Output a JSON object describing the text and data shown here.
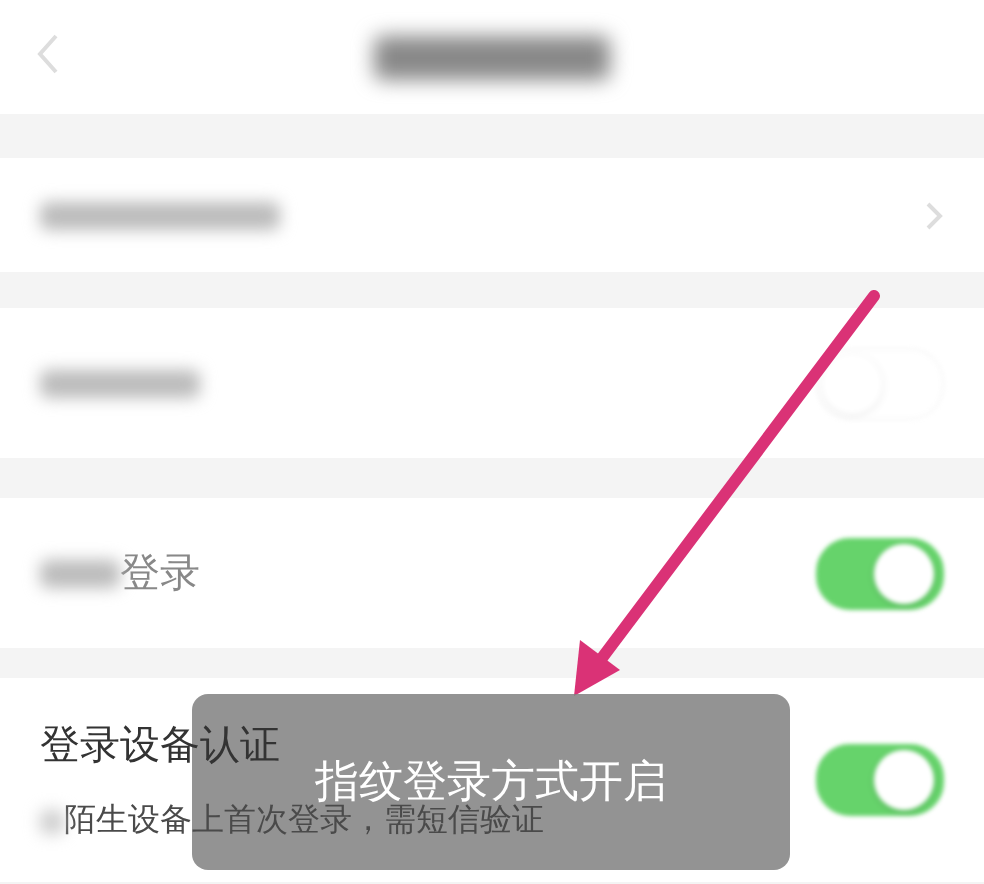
{
  "rows": [
    {
      "kind": "link"
    },
    {
      "kind": "toggle",
      "on": false
    },
    {
      "kind": "toggle",
      "on": true,
      "label": "登录"
    },
    {
      "kind": "toggle",
      "on": true,
      "label": "登录设备认证",
      "subtitle": "陌生设备上首次登录，需短信验证"
    }
  ],
  "toast": {
    "text": "指纹登录方式开启"
  }
}
